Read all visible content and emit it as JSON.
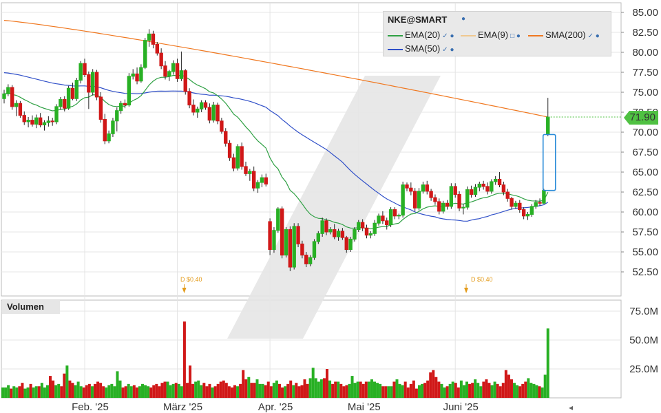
{
  "chart_data": {
    "type": "candlestick",
    "symbol": "NKE@SMART",
    "x_labels": [
      "Feb. '25",
      "März '25",
      "Apr. '25",
      "Mai '25",
      "Juni '25"
    ],
    "y_ticks": [
      "85.00",
      "82.50",
      "80.00",
      "77.50",
      "75.00",
      "72.50",
      "70.00",
      "67.50",
      "65.00",
      "62.50",
      "60.00",
      "57.50",
      "55.00",
      "52.50"
    ],
    "ylim": [
      50.0,
      86.0
    ],
    "volume_title": "Volumen",
    "volume_ticks": [
      "75.0M",
      "50.0M",
      "25.0M"
    ],
    "volume_max": 82,
    "last_price": "71.90",
    "legend": [
      {
        "name": "EMA(20)",
        "color": "#2ea043"
      },
      {
        "name": "EMA(9)",
        "color": "#f0c890"
      },
      {
        "name": "SMA(200)",
        "color": "#f07820"
      },
      {
        "name": "SMA(50)",
        "color": "#2f4fc8"
      }
    ],
    "dividends": [
      {
        "label": "D $0.40",
        "index": 43
      },
      {
        "label": "D $0.40",
        "index": 113
      }
    ],
    "candles": [
      [
        74.2,
        75.3,
        73.6,
        74.8
      ],
      [
        74.8,
        76.0,
        74.5,
        75.6
      ],
      [
        75.6,
        75.9,
        72.8,
        73.2
      ],
      [
        73.2,
        74.0,
        72.0,
        73.6
      ],
      [
        73.6,
        73.9,
        71.8,
        72.1
      ],
      [
        72.1,
        72.6,
        70.9,
        71.3
      ],
      [
        71.3,
        71.9,
        70.6,
        71.5
      ],
      [
        71.5,
        72.1,
        70.7,
        71.0
      ],
      [
        71.0,
        72.2,
        70.5,
        71.8
      ],
      [
        71.8,
        72.4,
        70.6,
        70.9
      ],
      [
        70.9,
        71.5,
        70.2,
        71.2
      ],
      [
        71.2,
        72.0,
        70.7,
        71.4
      ],
      [
        71.4,
        71.8,
        70.8,
        71.3
      ],
      [
        71.3,
        73.5,
        71.0,
        73.2
      ],
      [
        73.2,
        74.4,
        72.8,
        74.1
      ],
      [
        74.1,
        74.5,
        72.6,
        73.0
      ],
      [
        73.0,
        75.8,
        72.8,
        75.5
      ],
      [
        75.5,
        76.2,
        74.0,
        74.2
      ],
      [
        74.2,
        76.8,
        73.9,
        76.5
      ],
      [
        76.5,
        78.9,
        76.1,
        78.6
      ],
      [
        78.6,
        79.2,
        76.9,
        77.2
      ],
      [
        77.2,
        77.6,
        72.9,
        75.0
      ],
      [
        75.0,
        77.9,
        74.6,
        77.5
      ],
      [
        77.5,
        77.8,
        74.0,
        74.4
      ],
      [
        74.4,
        75.0,
        71.2,
        71.6
      ],
      [
        71.6,
        72.3,
        68.5,
        68.9
      ],
      [
        68.9,
        70.2,
        68.6,
        69.8
      ],
      [
        69.8,
        71.8,
        69.4,
        71.4
      ],
      [
        71.4,
        73.1,
        70.1,
        72.7
      ],
      [
        72.7,
        73.9,
        72.3,
        73.6
      ],
      [
        73.6,
        74.1,
        73.0,
        73.4
      ],
      [
        73.4,
        77.4,
        73.2,
        77.0
      ],
      [
        77.0,
        77.9,
        76.6,
        77.3
      ],
      [
        77.3,
        78.1,
        76.0,
        76.4
      ],
      [
        76.4,
        78.5,
        76.2,
        78.1
      ],
      [
        78.1,
        81.8,
        77.9,
        81.5
      ],
      [
        81.5,
        82.9,
        80.7,
        82.3
      ],
      [
        82.3,
        82.7,
        80.5,
        81.0
      ],
      [
        81.0,
        81.3,
        79.6,
        79.9
      ],
      [
        79.9,
        80.5,
        77.9,
        78.3
      ],
      [
        78.3,
        78.9,
        76.6,
        77.0
      ],
      [
        77.0,
        77.8,
        76.4,
        77.6
      ],
      [
        77.6,
        79.0,
        77.2,
        78.6
      ],
      [
        78.6,
        79.2,
        76.3,
        76.7
      ],
      [
        76.7,
        80.1,
        76.4,
        77.7
      ],
      [
        77.7,
        77.9,
        74.7,
        75.1
      ],
      [
        75.1,
        75.5,
        73.0,
        73.4
      ],
      [
        73.4,
        74.1,
        72.1,
        72.5
      ],
      [
        72.5,
        73.2,
        71.8,
        72.9
      ],
      [
        72.9,
        74.0,
        72.5,
        73.7
      ],
      [
        73.7,
        74.0,
        72.8,
        73.1
      ],
      [
        73.1,
        73.6,
        71.1,
        71.5
      ],
      [
        71.5,
        73.8,
        71.2,
        73.4
      ],
      [
        73.4,
        73.7,
        71.0,
        71.4
      ],
      [
        71.4,
        71.8,
        69.8,
        70.1
      ],
      [
        70.1,
        70.5,
        68.2,
        68.6
      ],
      [
        68.6,
        69.0,
        66.4,
        66.8
      ],
      [
        66.8,
        67.3,
        65.1,
        65.5
      ],
      [
        65.5,
        68.5,
        65.2,
        68.2
      ],
      [
        68.2,
        68.7,
        65.3,
        65.7
      ],
      [
        65.7,
        66.3,
        64.5,
        64.8
      ],
      [
        64.8,
        65.4,
        63.9,
        65.1
      ],
      [
        65.1,
        65.7,
        62.6,
        63.0
      ],
      [
        63.0,
        64.0,
        62.4,
        63.7
      ],
      [
        63.7,
        64.7,
        63.1,
        64.3
      ],
      [
        64.3,
        64.8,
        63.2,
        63.5
      ],
      [
        58.8,
        59.2,
        54.6,
        55.3
      ],
      [
        55.3,
        58.1,
        54.9,
        57.7
      ],
      [
        57.7,
        60.6,
        57.4,
        60.4
      ],
      [
        60.4,
        60.7,
        54.2,
        54.6
      ],
      [
        54.6,
        58.1,
        54.3,
        57.8
      ],
      [
        57.8,
        58.2,
        52.6,
        53.1
      ],
      [
        53.1,
        58.6,
        52.8,
        58.2
      ],
      [
        58.2,
        58.6,
        55.6,
        56.0
      ],
      [
        56.0,
        56.4,
        54.2,
        54.6
      ],
      [
        54.6,
        55.0,
        53.1,
        53.5
      ],
      [
        53.5,
        54.6,
        53.2,
        54.3
      ],
      [
        54.3,
        56.6,
        54.0,
        56.3
      ],
      [
        56.3,
        57.6,
        56.0,
        57.3
      ],
      [
        57.3,
        59.3,
        56.9,
        58.9
      ],
      [
        58.9,
        59.2,
        57.1,
        57.5
      ],
      [
        57.5,
        58.1,
        57.2,
        57.8
      ],
      [
        57.8,
        58.5,
        56.6,
        56.9
      ],
      [
        56.9,
        57.9,
        56.4,
        57.6
      ],
      [
        57.6,
        58.0,
        56.5,
        56.8
      ],
      [
        56.8,
        57.0,
        54.9,
        55.3
      ],
      [
        55.3,
        56.9,
        55.0,
        56.6
      ],
      [
        56.6,
        58.1,
        56.3,
        57.8
      ],
      [
        57.8,
        59.0,
        57.5,
        58.7
      ],
      [
        58.7,
        59.1,
        57.6,
        58.0
      ],
      [
        58.0,
        58.4,
        56.7,
        57.1
      ],
      [
        57.1,
        57.6,
        56.7,
        57.3
      ],
      [
        57.3,
        59.0,
        57.0,
        58.6
      ],
      [
        58.6,
        59.8,
        58.3,
        59.5
      ],
      [
        59.5,
        60.1,
        58.5,
        58.9
      ],
      [
        58.9,
        59.3,
        57.8,
        58.4
      ],
      [
        58.4,
        60.6,
        58.1,
        60.3
      ],
      [
        60.3,
        60.6,
        59.1,
        59.5
      ],
      [
        59.5,
        59.8,
        59.1,
        59.6
      ],
      [
        59.6,
        63.8,
        59.3,
        63.4
      ],
      [
        63.4,
        63.7,
        62.6,
        63.0
      ],
      [
        63.0,
        63.7,
        62.1,
        62.6
      ],
      [
        62.6,
        63.0,
        60.1,
        60.5
      ],
      [
        60.5,
        63.0,
        60.2,
        62.6
      ],
      [
        62.6,
        63.8,
        62.3,
        63.4
      ],
      [
        63.4,
        63.9,
        62.2,
        62.6
      ],
      [
        62.6,
        62.9,
        61.4,
        61.8
      ],
      [
        61.8,
        62.2,
        60.9,
        61.3
      ],
      [
        61.3,
        61.7,
        59.7,
        60.1
      ],
      [
        60.1,
        61.4,
        59.8,
        61.1
      ],
      [
        61.1,
        61.5,
        60.3,
        60.7
      ],
      [
        60.7,
        63.6,
        60.4,
        63.2
      ],
      [
        63.2,
        63.6,
        61.8,
        62.2
      ],
      [
        62.2,
        62.6,
        60.1,
        60.5
      ],
      [
        60.5,
        61.0,
        59.7,
        60.6
      ],
      [
        60.6,
        63.2,
        60.3,
        62.8
      ],
      [
        62.8,
        63.3,
        61.8,
        62.2
      ],
      [
        62.2,
        63.5,
        61.9,
        63.1
      ],
      [
        63.1,
        63.8,
        62.6,
        63.5
      ],
      [
        63.5,
        63.9,
        62.8,
        63.2
      ],
      [
        63.2,
        63.7,
        62.2,
        62.6
      ],
      [
        62.6,
        64.1,
        62.3,
        63.8
      ],
      [
        63.8,
        64.5,
        63.4,
        64.1
      ],
      [
        64.1,
        65.0,
        63.1,
        63.4
      ],
      [
        63.4,
        63.8,
        62.1,
        62.5
      ],
      [
        62.5,
        62.9,
        61.3,
        61.7
      ],
      [
        61.7,
        61.9,
        60.3,
        60.7
      ],
      [
        60.7,
        61.4,
        60.4,
        61.1
      ],
      [
        61.1,
        61.5,
        59.9,
        60.3
      ],
      [
        60.3,
        60.6,
        59.1,
        59.5
      ],
      [
        59.5,
        60.0,
        59.0,
        59.7
      ],
      [
        59.7,
        61.0,
        59.4,
        60.7
      ],
      [
        60.7,
        61.5,
        60.4,
        61.2
      ],
      [
        61.2,
        61.7,
        60.8,
        61.1
      ],
      [
        61.1,
        62.9,
        61.0,
        62.7
      ],
      [
        69.7,
        74.3,
        69.5,
        71.9
      ]
    ],
    "volume": [
      9,
      9,
      11,
      8,
      10,
      9,
      10,
      13,
      8,
      9,
      12,
      9,
      10,
      10,
      13,
      9,
      11,
      19,
      15,
      11,
      12,
      10,
      21,
      28,
      15,
      13,
      11,
      14,
      10,
      9,
      11,
      12,
      10,
      12,
      14,
      13,
      10,
      9,
      11,
      12,
      10,
      23,
      15,
      9,
      10,
      12,
      10,
      11,
      9,
      10,
      12,
      11,
      10,
      9,
      11,
      12,
      10,
      13,
      14,
      14,
      11,
      12,
      13,
      12,
      10,
      66,
      13,
      28,
      12,
      14,
      15,
      11,
      13,
      10,
      12,
      9,
      10,
      12,
      14,
      15,
      13,
      10,
      9,
      11,
      10,
      12,
      24,
      16,
      18,
      13,
      13,
      16,
      12,
      12,
      11,
      14,
      10,
      13,
      15,
      12,
      9,
      10,
      12,
      15,
      11,
      13,
      10,
      11,
      16,
      12,
      17,
      26,
      17,
      14,
      16,
      17,
      25,
      15,
      12,
      14,
      14,
      12,
      10,
      11,
      12,
      19,
      13,
      14,
      14,
      12,
      14,
      14,
      16,
      14,
      13,
      12,
      10,
      10,
      10,
      10,
      14,
      16,
      12,
      11,
      14,
      9,
      12,
      15,
      8,
      11,
      12,
      13,
      15,
      22,
      24,
      18,
      14,
      12,
      9,
      10,
      12,
      14,
      13,
      9,
      15,
      11,
      14,
      12,
      13,
      16,
      13,
      10,
      14,
      16,
      13,
      11,
      14,
      12,
      10,
      13,
      24,
      20,
      16,
      13,
      11,
      10,
      12,
      14,
      17,
      13,
      12,
      11,
      10,
      9,
      20,
      60
    ]
  }
}
